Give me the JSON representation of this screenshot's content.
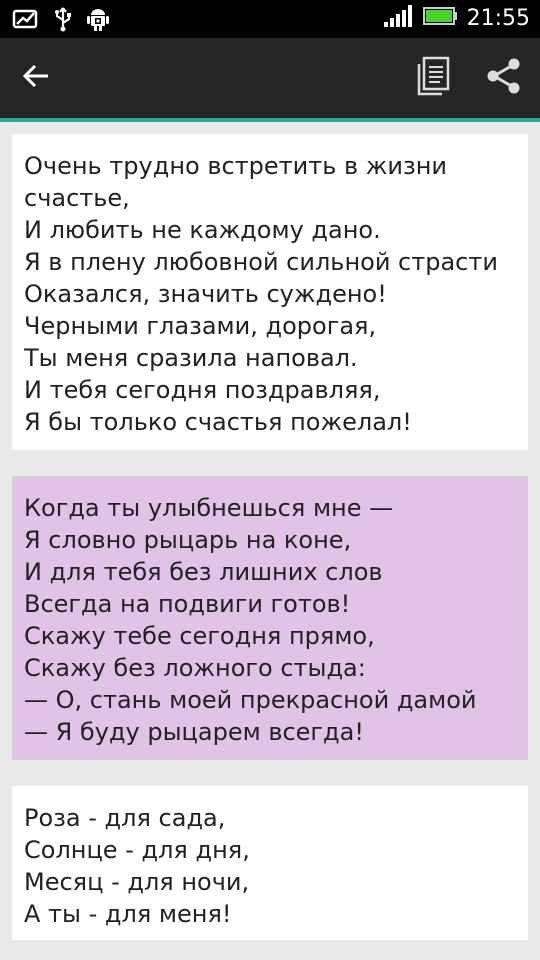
{
  "status_bar": {
    "time": "21:55",
    "icons": [
      "notification-image-icon",
      "usb-icon",
      "android-debug-icon",
      "signal-icon",
      "battery-icon"
    ]
  },
  "action_bar": {
    "back_icon": "arrow-left-icon",
    "copy_icon": "copy-icon",
    "share_icon": "share-icon"
  },
  "colors": {
    "status_bar": "#000000",
    "action_bar": "#262626",
    "accent": "#2aa89a",
    "page_background": "#e9e9e9",
    "card_default": "#ffffff",
    "card_selected": "#e2c3e8",
    "battery": "#4cd02c"
  },
  "poems": [
    {
      "selected": false,
      "lines": [
        "Очень трудно встретить в жизни",
        "счастье,",
        "И любить не каждому дано.",
        "Я в плену любовной сильной страсти",
        "Оказался, значить суждено!",
        "Черными глазами, дорогая,",
        "Ты меня сразила наповал.",
        "И тебя сегодня поздравляя,",
        "Я бы только счастья пожелал!"
      ]
    },
    {
      "selected": true,
      "lines": [
        "Когда ты улыбнешься мне —",
        "Я словно рыцарь на коне,",
        "И для тебя без лишних слов",
        "Всегда на подвиги готов!",
        "Скажу тебе сегодня прямо,",
        "Скажу без ложного стыда:",
        "— О, стань моей прекрасной дамой",
        "— Я буду рыцарем всегда!"
      ]
    },
    {
      "selected": false,
      "lines": [
        "Роза - для сада,",
        "Солнце - для дня,",
        "Месяц - для ночи,",
        "А ты - для меня!"
      ]
    }
  ]
}
